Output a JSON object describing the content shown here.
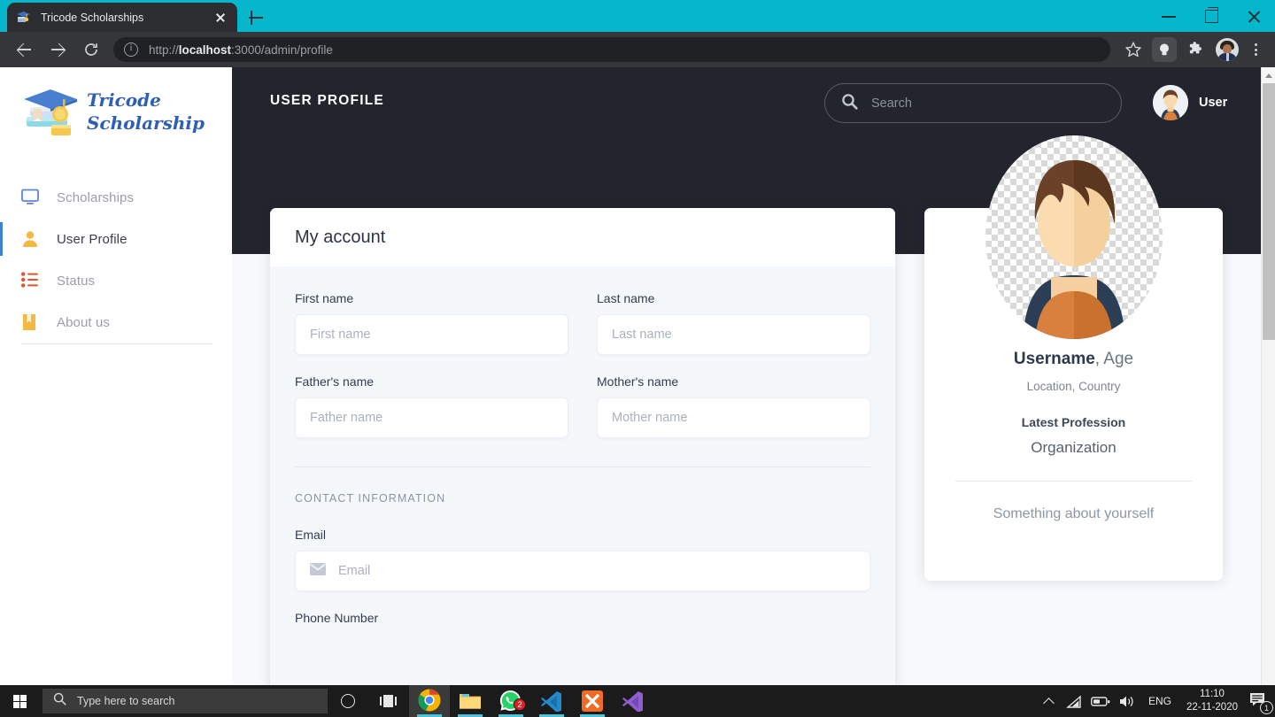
{
  "browser": {
    "tab": {
      "title": "Tricode Scholarships",
      "favicon": "graduation-cap-icon",
      "close": "close-icon"
    },
    "new_tab_label": "+",
    "window_controls": {
      "minimize": "minimize-icon",
      "maximize": "restore-icon",
      "close": "close-icon"
    },
    "toolbar": {
      "back": "back-arrow-icon",
      "forward": "forward-arrow-icon",
      "reload": "reload-icon",
      "site_info": "info-icon",
      "url_prefix": "http://",
      "url_host": "localhost",
      "url_rest": ":3000/admin/profile",
      "bookmark": "star-icon",
      "reading": "lightbulb-icon",
      "extensions": "puzzle-icon",
      "profile": "profile-avatar",
      "menu": "kebab-menu-icon"
    }
  },
  "sidebar": {
    "logo": {
      "line1": "Tricode",
      "line2": "Scholarship",
      "icon": "graduation-cap-books-logo"
    },
    "items": [
      {
        "label": "Scholarships",
        "icon": "monitor-icon",
        "active": false
      },
      {
        "label": "User Profile",
        "icon": "person-icon",
        "active": true
      },
      {
        "label": "Status",
        "icon": "list-icon",
        "active": false
      },
      {
        "label": "About us",
        "icon": "book-icon",
        "active": false
      }
    ]
  },
  "header": {
    "title": "USER PROFILE",
    "search": {
      "placeholder": "Search",
      "value": "",
      "icon": "search-icon"
    },
    "user": {
      "label": "User",
      "avatar": "user-avatar"
    }
  },
  "account_card": {
    "title": "My account",
    "fields": [
      {
        "label": "First name",
        "placeholder": "First name",
        "value": "",
        "name": "first-name"
      },
      {
        "label": "Last name",
        "placeholder": "Last name",
        "value": "",
        "name": "last-name"
      },
      {
        "label": "Father's name",
        "placeholder": "Father name",
        "value": "",
        "name": "fathers-name"
      },
      {
        "label": "Mother's name",
        "placeholder": "Mother name",
        "value": "",
        "name": "mothers-name"
      }
    ],
    "section_title": "CONTACT INFORMATION",
    "email": {
      "label": "Email",
      "placeholder": "Email",
      "value": "",
      "icon": "envelope-icon"
    },
    "phone_label": "Phone Number"
  },
  "profile_card": {
    "avatar": "user-illustration-avatar",
    "username": "Username",
    "age": ", Age",
    "location": "Location, Country",
    "profession": "Latest Profession",
    "organization": "Organization",
    "about": "Something about yourself"
  },
  "taskbar": {
    "start": "windows-start-icon",
    "search_placeholder": "Type here to search",
    "cortana": "cortana-icon",
    "task_view": "task-view-icon",
    "apps": [
      {
        "name": "chrome-icon",
        "badge": ""
      },
      {
        "name": "file-explorer-icon",
        "badge": ""
      },
      {
        "name": "whatsapp-icon",
        "badge": "2"
      },
      {
        "name": "vscode-icon",
        "badge": ""
      },
      {
        "name": "xampp-icon",
        "badge": ""
      },
      {
        "name": "vscode-insiders-icon",
        "badge": ""
      }
    ],
    "tray": {
      "chevron": "show-hidden-icons",
      "wifi": "wifi-icon",
      "battery": "battery-icon",
      "volume": "speaker-icon",
      "language": "ENG",
      "time": "11:10",
      "date": "22-11-2020",
      "notifications": "notification-icon",
      "notification_count": "1"
    }
  },
  "colors": {
    "tab_strip": "#06b6cb",
    "hero": "#22252d",
    "page_bg": "#f7f9fc",
    "accent_blue": "#3f7fd4",
    "logo_blue": "#2f5fb5"
  }
}
